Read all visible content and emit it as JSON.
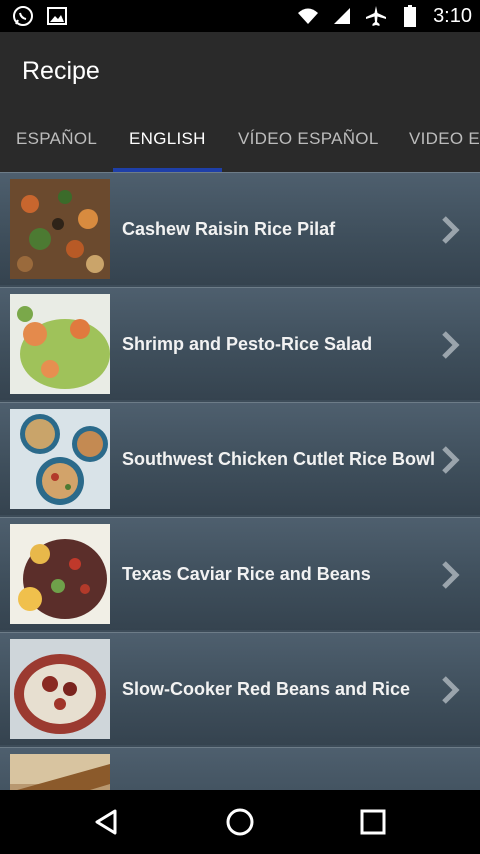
{
  "status_bar": {
    "time": "3:10"
  },
  "app_bar": {
    "title": "Recipe"
  },
  "tabs": [
    {
      "label": "ESPAÑOL"
    },
    {
      "label": "ENGLISH"
    },
    {
      "label": "VÍDEO ESPAÑOL"
    },
    {
      "label": "VIDEO EN"
    }
  ],
  "active_tab": "ENGLISH",
  "recipes": [
    {
      "title": "Cashew Raisin Rice Pilaf"
    },
    {
      "title": "Shrimp and Pesto-Rice Salad"
    },
    {
      "title": "Southwest Chicken Cutlet Rice Bowl"
    },
    {
      "title": "Texas Caviar Rice and Beans"
    },
    {
      "title": " Slow-Cooker Red Beans and Rice"
    },
    {
      "title": ""
    }
  ],
  "colors": {
    "accent": "#1e3fa8",
    "background": "#2a2a2a",
    "list_bg": "#4e5f6e"
  },
  "icons": [
    "whatsapp-icon",
    "image-icon",
    "wifi-icon",
    "signal-icon",
    "airplane-icon",
    "battery-icon",
    "chevron-right-icon",
    "back-icon",
    "home-icon",
    "recents-icon"
  ]
}
